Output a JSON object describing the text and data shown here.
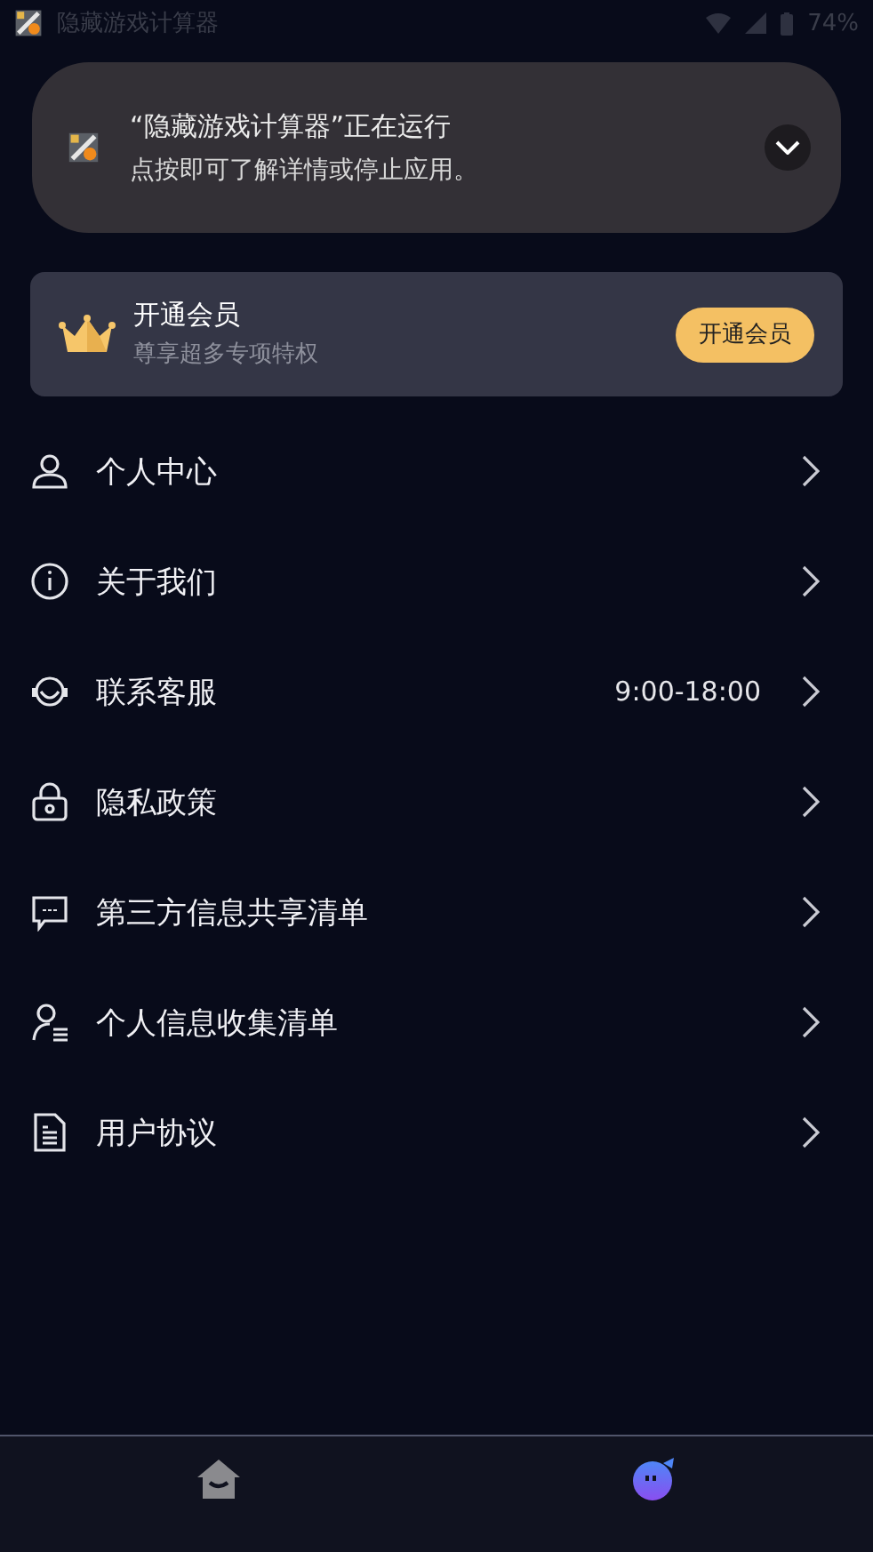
{
  "status_bar": {
    "app_name": "隐藏游戏计算器",
    "battery": "74%"
  },
  "notification": {
    "title": "“隐藏游戏计算器”正在运行",
    "text": "点按即可了解详情或停止应用。",
    "expanded": false
  },
  "vip_card": {
    "title": "开通会员",
    "subtitle": "尊享超多专项特权",
    "button": "开通会员"
  },
  "menu": [
    {
      "label": "个人中心"
    },
    {
      "label": "关于我们"
    },
    {
      "label": "联系客服",
      "value": "9:00-18:00"
    },
    {
      "label": "隐私政策"
    },
    {
      "label": "第三方信息共享清单"
    },
    {
      "label": "个人信息收集清单"
    },
    {
      "label": "用户协议"
    }
  ],
  "bottom_nav": [
    {
      "selected": false
    },
    {
      "selected": true
    }
  ]
}
